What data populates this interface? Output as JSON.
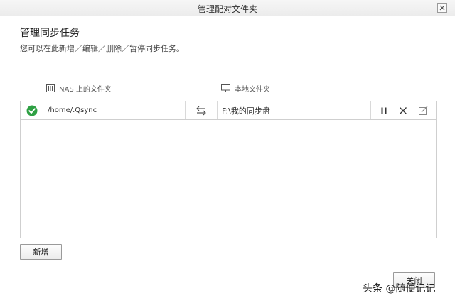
{
  "window": {
    "title": "管理配对文件夹"
  },
  "content": {
    "heading": "管理同步任务",
    "description": "您可以在此新增／编辑／删除／暂停同步任务。"
  },
  "columns": {
    "nas_header": "NAS 上的文件夹",
    "nas_icon": "nas-device-icon",
    "local_header": "本地文件夹",
    "local_icon": "monitor-icon"
  },
  "rows": [
    {
      "status_icon": "check-circle-icon",
      "status_color": "#2ea043",
      "nas_path": "/home/.Qsync",
      "direction_icon": "two-way-sync-icon",
      "local_path": "F:\\我的同步盘",
      "actions": [
        "pause-icon",
        "delete-icon",
        "edit-icon"
      ]
    }
  ],
  "buttons": {
    "add": "新增",
    "close": "关闭"
  },
  "watermark": "头条 @随便记记"
}
